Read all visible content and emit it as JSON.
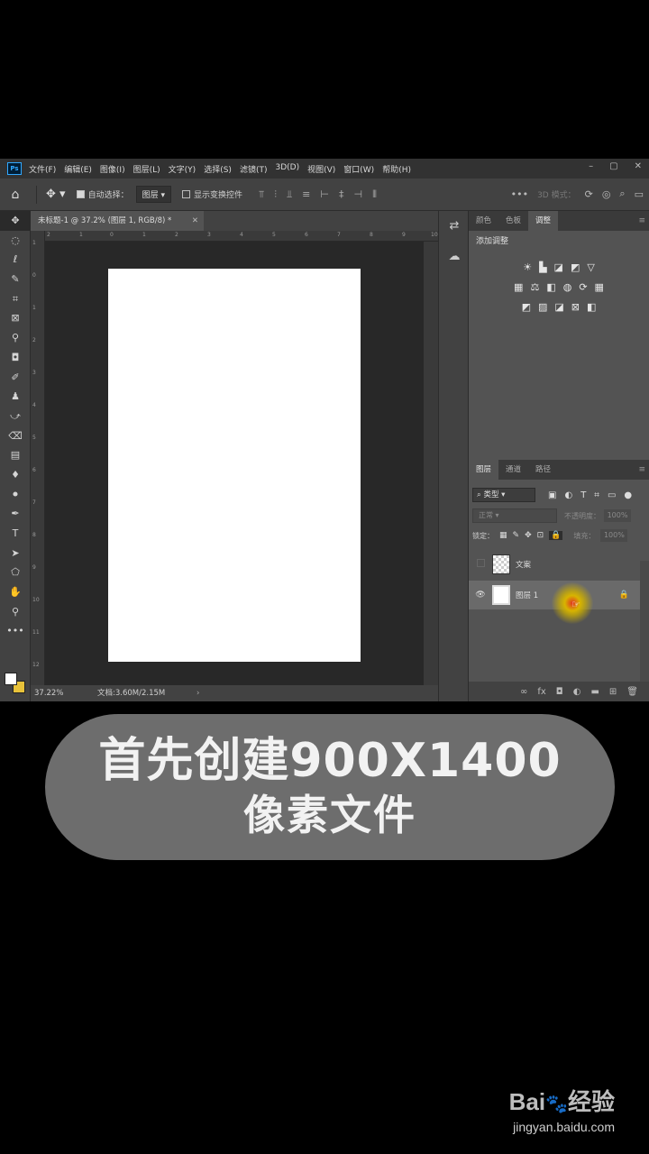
{
  "menubar": {
    "logo": "Ps",
    "items": [
      "文件(F)",
      "编辑(E)",
      "图像(I)",
      "图层(L)",
      "文字(Y)",
      "选择(S)",
      "滤镜(T)",
      "3D(D)",
      "视图(V)",
      "窗口(W)",
      "帮助(H)"
    ]
  },
  "options_bar": {
    "auto_select_label": "自动选择：",
    "auto_select_value": "图层",
    "show_transform_label": "显示变换控件",
    "mode_3d_label": "3D 模式："
  },
  "document": {
    "tab_title": "未标题-1 @ 37.2% (图层 1, RGB/8) *",
    "ruler_top_labels": [
      "2",
      "1",
      "0",
      "1",
      "2",
      "3",
      "4",
      "5",
      "6",
      "7",
      "8",
      "9",
      "10"
    ],
    "ruler_left_labels": [
      "1",
      "0",
      "1",
      "2",
      "3",
      "4",
      "5",
      "6",
      "7",
      "8",
      "9",
      "10",
      "11",
      "12"
    ],
    "zoom": "37.22%",
    "doc_size": "文档:3.60M/2.15M"
  },
  "adjustments_panel": {
    "tabs": [
      "颜色",
      "色板",
      "调整"
    ],
    "active_tab": "调整",
    "title": "添加调整"
  },
  "layers_panel": {
    "tabs": [
      "图层",
      "通道",
      "路径"
    ],
    "filter_kind": "类型",
    "blend_mode": "正常",
    "opacity_label": "不透明度：",
    "opacity_value": "100%",
    "lock_label": "锁定：",
    "fill_label": "填充：",
    "fill_value": "100%",
    "layers": [
      {
        "name": "文案",
        "visible": false,
        "thumb": "transparent"
      },
      {
        "name": "图层 1",
        "visible": true,
        "thumb": "white",
        "selected": true,
        "locked": true
      }
    ]
  },
  "caption": {
    "line1": "首先创建900X1400",
    "line2": "像素文件"
  },
  "watermark": {
    "brand": "Bai",
    "brand_suffix": "经验",
    "url": "jingyan.baidu.com"
  },
  "colors": {
    "foreground": "#ffffff",
    "background": "#e8c23a",
    "ui_dark": "#323232",
    "ui_mid": "#535353"
  }
}
